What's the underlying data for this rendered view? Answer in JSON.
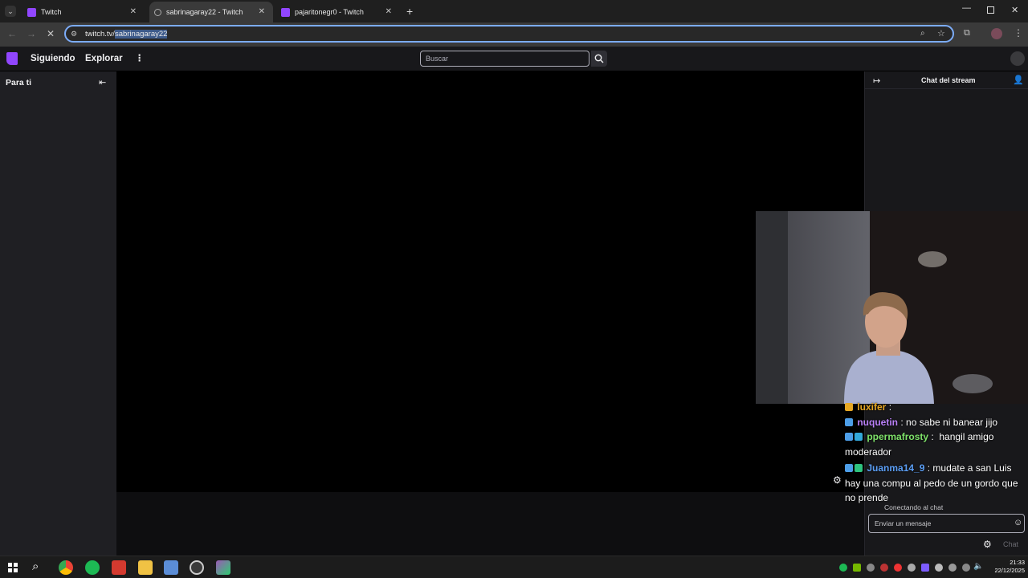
{
  "browser": {
    "tabs": [
      {
        "title": "Twitch",
        "active": false
      },
      {
        "title": "sabrinagaray22 - Twitch",
        "active": true
      },
      {
        "title": "pajaritonegr0 - Twitch",
        "active": false
      }
    ],
    "url_prefix": "twitch.tv/",
    "url_selected": "sabrinagaray22"
  },
  "twitch": {
    "nav": {
      "following": "Siguiendo",
      "explore": "Explorar",
      "search_placeholder": "Buscar"
    },
    "sidebar": {
      "title": "Para ti"
    },
    "chat": {
      "header": "Chat del stream",
      "status": "Conectando al chat",
      "input_placeholder": "Enviar un mensaje",
      "send_label": "Chat",
      "messages": [
        {
          "user": "luxifer",
          "text": "",
          "color": "#e6a723"
        },
        {
          "user": "nuquetin",
          "text": "no sabe ni banear jijo",
          "color": "#b980f7"
        },
        {
          "user": "ppermafrosty",
          "text": "hangil amigo moderador",
          "color": "#7fe36a"
        },
        {
          "user": "Juanma14_9",
          "text": "mudate a san Luis hay una compu al pedo de un gordo que no prende",
          "color": "#5b9ef5"
        }
      ]
    }
  },
  "taskbar": {
    "time": "21:33",
    "date": "22/12/2025"
  }
}
